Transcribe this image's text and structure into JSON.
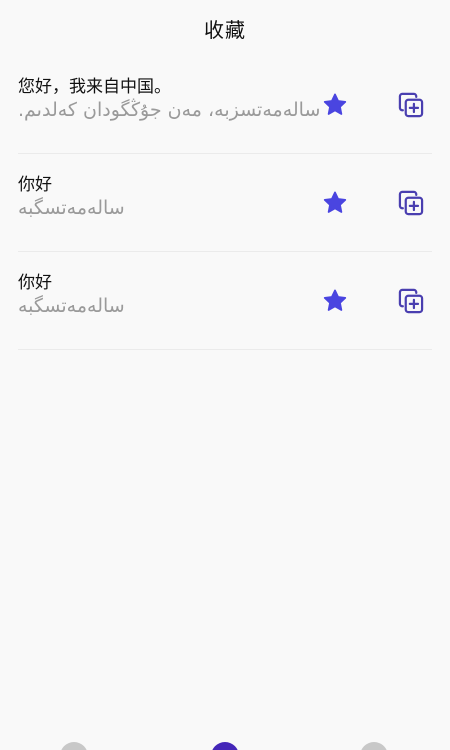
{
  "header": {
    "title": "收藏"
  },
  "favorites": [
    {
      "zh": "您好，我来自中国。",
      "ug": "سالەمەتسزبە، مەن جۇڭگودان كەلدىم."
    },
    {
      "zh": "你好",
      "ug": "سالەمەتسگبە"
    },
    {
      "zh": "你好",
      "ug": "سالەمەتسگبە"
    }
  ],
  "icons": {
    "star": "star-icon",
    "copy": "copy-add-icon"
  },
  "colors": {
    "star": "#4a45e0",
    "copy": "#4a3fb0",
    "nav_inactive": "#c8c8c8",
    "nav_active": "#4426b8"
  }
}
